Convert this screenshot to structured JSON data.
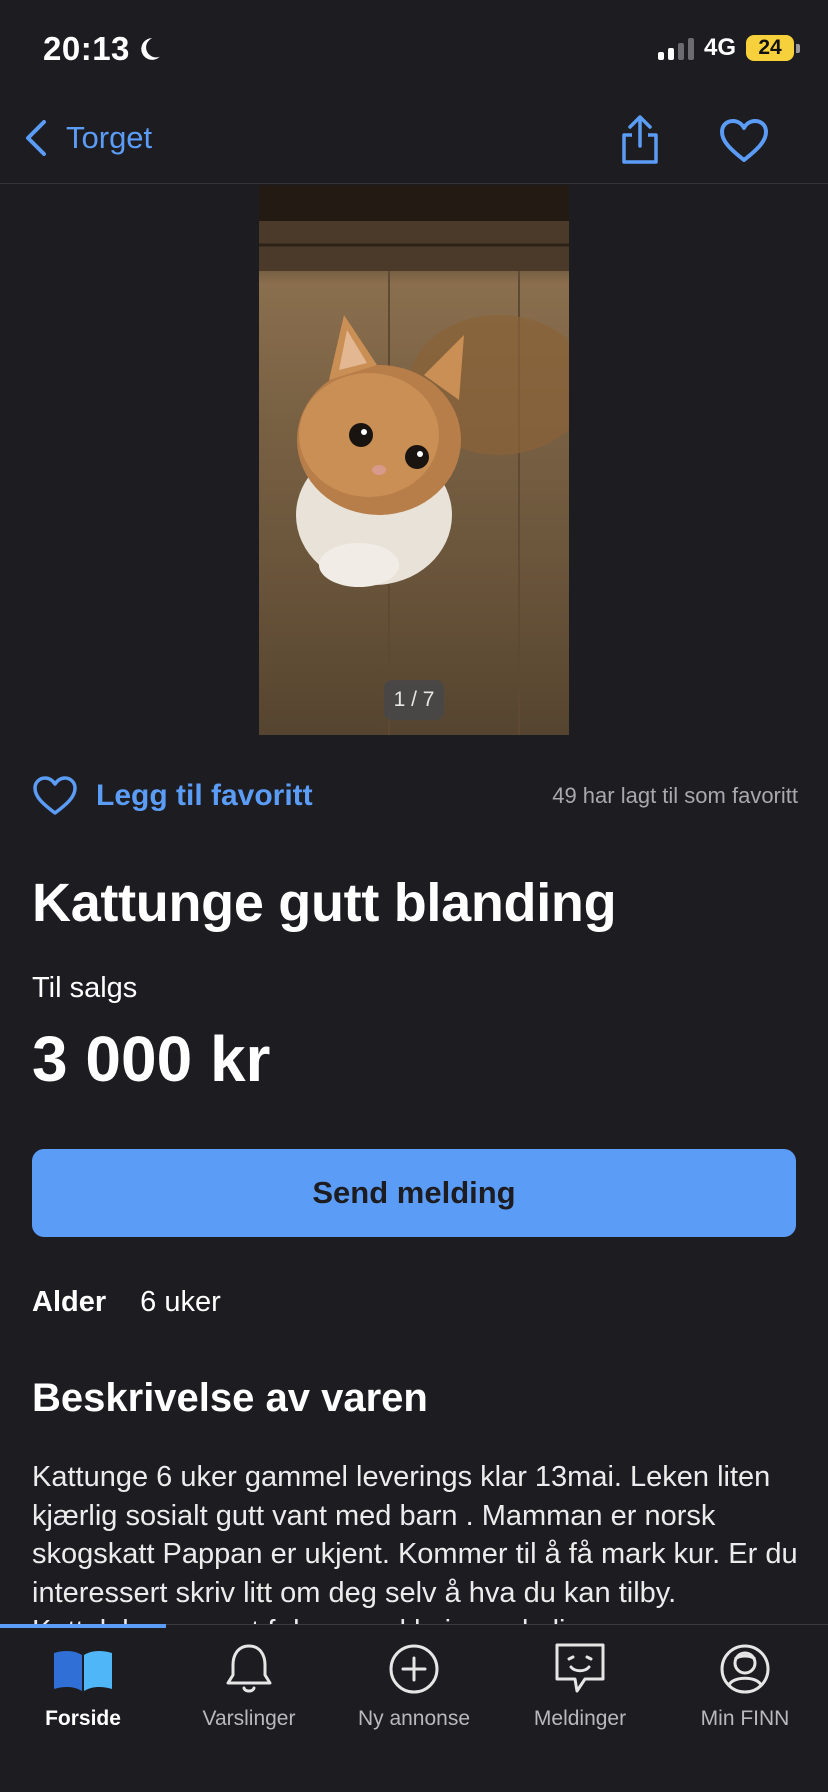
{
  "status": {
    "time": "20:13",
    "network": "4G",
    "battery": "24"
  },
  "nav": {
    "back_label": "Torget"
  },
  "gallery": {
    "counter": "1 / 7"
  },
  "favorite": {
    "label": "Legg til favoritt",
    "count_text": "49 har lagt til som favoritt"
  },
  "listing": {
    "title": "Kattunge gutt blanding",
    "sale_type": "Til salgs",
    "price": "3 000 kr",
    "send_button": "Send melding",
    "age_label": "Alder",
    "age_value": "6 uker",
    "description_heading": "Beskrivelse av varen",
    "description": "Kattunge 6 uker gammel leverings klar 13mai. Leken liten kjærlig sosialt gutt vant med barn . Mamman er norsk skogskatt Pappan er ukjent. Kommer til å få mark kur. Er du interessert skriv litt om deg selv å hva du kan tilby. Katteleker og mat følger med hvis ønskelig"
  },
  "tabs": [
    {
      "label": "Forside",
      "icon": "book-icon",
      "active": true
    },
    {
      "label": "Varslinger",
      "icon": "bell-icon",
      "active": false
    },
    {
      "label": "Ny annonse",
      "icon": "plus-circle-icon",
      "active": false
    },
    {
      "label": "Meldinger",
      "icon": "chat-icon",
      "active": false
    },
    {
      "label": "Min FINN",
      "icon": "user-circle-icon",
      "active": false
    }
  ],
  "colors": {
    "accent": "#5b9cf6",
    "background": "#1c1c21",
    "battery": "#f7d13b"
  }
}
